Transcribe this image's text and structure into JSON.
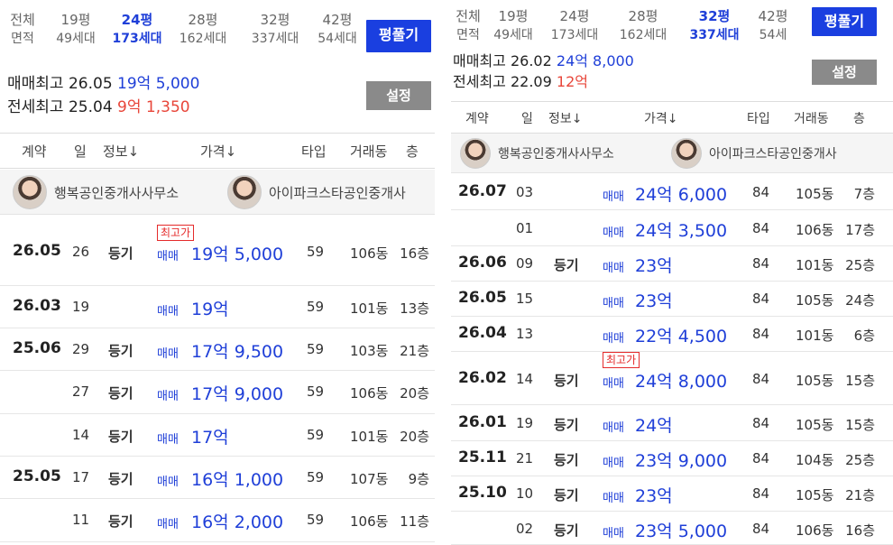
{
  "left": {
    "tabs": [
      {
        "l1": "전체",
        "l2": "면적",
        "active": false
      },
      {
        "l1": "19평",
        "l2": "49세대",
        "active": false
      },
      {
        "l1": "24평",
        "l2": "173세대",
        "active": true
      },
      {
        "l1": "28평",
        "l2": "162세대",
        "active": false
      },
      {
        "l1": "32평",
        "l2": "337세대",
        "active": false
      },
      {
        "l1": "42평",
        "l2": "54세대",
        "active": false
      }
    ],
    "button": "평풀기",
    "sale_label": "매매최고",
    "sale_date": "26.05",
    "sale_price": "19억 5,000",
    "rent_label": "전세최고",
    "rent_date": "25.04",
    "rent_price": "9억 1,350",
    "setting": "설정",
    "headers": {
      "contract": "계약",
      "day": "일",
      "info": "정보↓",
      "price": "가격↓",
      "type": "타입",
      "dong": "거래동",
      "floor": "층"
    },
    "agent1": "행복공인중개사사무소",
    "agent2": "아이파크스타공인중개사",
    "rows": [
      {
        "date": "26.05",
        "day": "26",
        "info": "등기",
        "kind": "매매",
        "price": "19억 5,000",
        "type": "59",
        "dong": "106동",
        "floor": "16층",
        "badge": "최고가"
      },
      {
        "date": "26.03",
        "day": "19",
        "info": "",
        "kind": "매매",
        "price": "19억",
        "type": "59",
        "dong": "101동",
        "floor": "13층",
        "badge": ""
      },
      {
        "date": "25.06",
        "day": "29",
        "info": "등기",
        "kind": "매매",
        "price": "17억 9,500",
        "type": "59",
        "dong": "103동",
        "floor": "21층",
        "badge": ""
      },
      {
        "date": "",
        "day": "27",
        "info": "등기",
        "kind": "매매",
        "price": "17억 9,000",
        "type": "59",
        "dong": "106동",
        "floor": "20층",
        "badge": ""
      },
      {
        "date": "",
        "day": "14",
        "info": "등기",
        "kind": "매매",
        "price": "17억",
        "type": "59",
        "dong": "101동",
        "floor": "20층",
        "badge": ""
      },
      {
        "date": "25.05",
        "day": "17",
        "info": "등기",
        "kind": "매매",
        "price": "16억 1,000",
        "type": "59",
        "dong": "107동",
        "floor": "9층",
        "badge": ""
      },
      {
        "date": "",
        "day": "11",
        "info": "등기",
        "kind": "매매",
        "price": "16억 2,000",
        "type": "59",
        "dong": "106동",
        "floor": "11층",
        "badge": ""
      }
    ]
  },
  "right": {
    "tabs": [
      {
        "l1": "전체",
        "l2": "면적",
        "active": false
      },
      {
        "l1": "19평",
        "l2": "49세대",
        "active": false
      },
      {
        "l1": "24평",
        "l2": "173세대",
        "active": false
      },
      {
        "l1": "28평",
        "l2": "162세대",
        "active": false
      },
      {
        "l1": "32평",
        "l2": "337세대",
        "active": true
      },
      {
        "l1": "42평",
        "l2": "54세",
        "active": false
      }
    ],
    "button": "평풀기",
    "sale_label": "매매최고",
    "sale_date": "26.02",
    "sale_price": "24억 8,000",
    "rent_label": "전세최고",
    "rent_date": "22.09",
    "rent_price": "12억",
    "setting": "설정",
    "headers": {
      "contract": "계약",
      "day": "일",
      "info": "정보↓",
      "price": "가격↓",
      "type": "타입",
      "dong": "거래동",
      "floor": "층"
    },
    "agent1": "행복공인중개사사무소",
    "agent2": "아이파크스타공인중개사",
    "rows": [
      {
        "date": "26.07",
        "day": "03",
        "info": "",
        "kind": "매매",
        "price": "24억 6,000",
        "type": "84",
        "dong": "105동",
        "floor": "7층",
        "badge": ""
      },
      {
        "date": "",
        "day": "01",
        "info": "",
        "kind": "매매",
        "price": "24억 3,500",
        "type": "84",
        "dong": "106동",
        "floor": "17층",
        "badge": ""
      },
      {
        "date": "26.06",
        "day": "09",
        "info": "등기",
        "kind": "매매",
        "price": "23억",
        "type": "84",
        "dong": "101동",
        "floor": "25층",
        "badge": ""
      },
      {
        "date": "26.05",
        "day": "15",
        "info": "",
        "kind": "매매",
        "price": "23억",
        "type": "84",
        "dong": "105동",
        "floor": "24층",
        "badge": ""
      },
      {
        "date": "26.04",
        "day": "13",
        "info": "",
        "kind": "매매",
        "price": "22억 4,500",
        "type": "84",
        "dong": "101동",
        "floor": "6층",
        "badge": ""
      },
      {
        "date": "26.02",
        "day": "14",
        "info": "등기",
        "kind": "매매",
        "price": "24억 8,000",
        "type": "84",
        "dong": "105동",
        "floor": "15층",
        "badge": "최고가"
      },
      {
        "date": "26.01",
        "day": "19",
        "info": "등기",
        "kind": "매매",
        "price": "24억",
        "type": "84",
        "dong": "105동",
        "floor": "15층",
        "badge": ""
      },
      {
        "date": "25.11",
        "day": "21",
        "info": "등기",
        "kind": "매매",
        "price": "23억 9,000",
        "type": "84",
        "dong": "104동",
        "floor": "25층",
        "badge": ""
      },
      {
        "date": "25.10",
        "day": "10",
        "info": "등기",
        "kind": "매매",
        "price": "23억",
        "type": "84",
        "dong": "105동",
        "floor": "21층",
        "badge": ""
      },
      {
        "date": "",
        "day": "02",
        "info": "등기",
        "kind": "매매",
        "price": "23억 5,000",
        "type": "84",
        "dong": "106동",
        "floor": "16층",
        "badge": ""
      }
    ]
  }
}
